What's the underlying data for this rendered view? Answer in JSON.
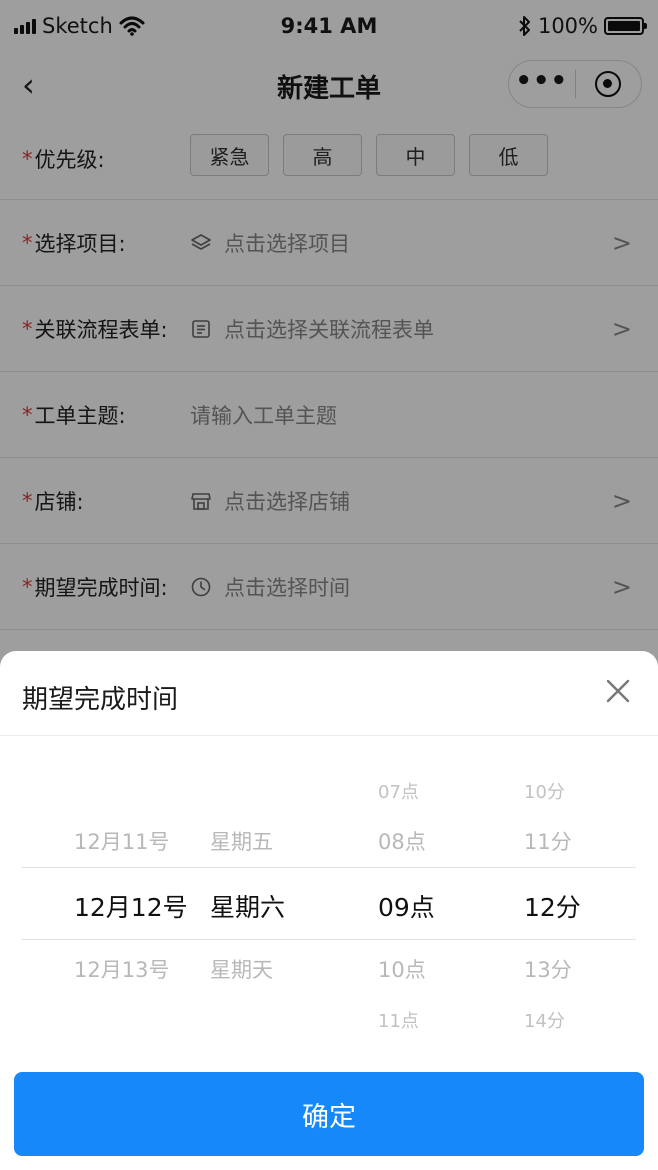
{
  "status_bar": {
    "carrier": "Sketch",
    "time": "9:41 AM",
    "battery": "100%"
  },
  "nav": {
    "back_icon": "‹",
    "title": "新建工单",
    "more_icon": "•••"
  },
  "form": {
    "required_mark": "*",
    "priority": {
      "label": "优先级:",
      "options": [
        "紧急",
        "高",
        "中",
        "低"
      ]
    },
    "project": {
      "label": "选择项目:",
      "placeholder": "点击选择项目",
      "icon": "layers-icon"
    },
    "flow_form": {
      "label": "关联流程表单:",
      "placeholder": "点击选择关联流程表单",
      "icon": "document-icon"
    },
    "subject": {
      "label": "工单主题:",
      "placeholder": "请输入工单主题"
    },
    "store": {
      "label": "店铺:",
      "placeholder": "点击选择店铺",
      "icon": "store-icon"
    },
    "due_time": {
      "label": "期望完成时间:",
      "placeholder": "点击选择时间",
      "icon": "clock-icon"
    },
    "chevron": ">"
  },
  "sheet": {
    "title": "期望完成时间",
    "picker": {
      "dates": [
        "12月11号",
        "12月12号",
        "12月13号"
      ],
      "weekdays": [
        "星期五",
        "星期六",
        "星期天"
      ],
      "hours": [
        "07点",
        "08点",
        "09点",
        "10点",
        "11点"
      ],
      "minutes": [
        "10分",
        "11分",
        "12分",
        "13分",
        "14分"
      ]
    },
    "confirm_label": "确定"
  },
  "colors": {
    "primary": "#1788fa",
    "required": "#e03a3a",
    "overlay": "rgba(0,0,0,0.38)"
  }
}
